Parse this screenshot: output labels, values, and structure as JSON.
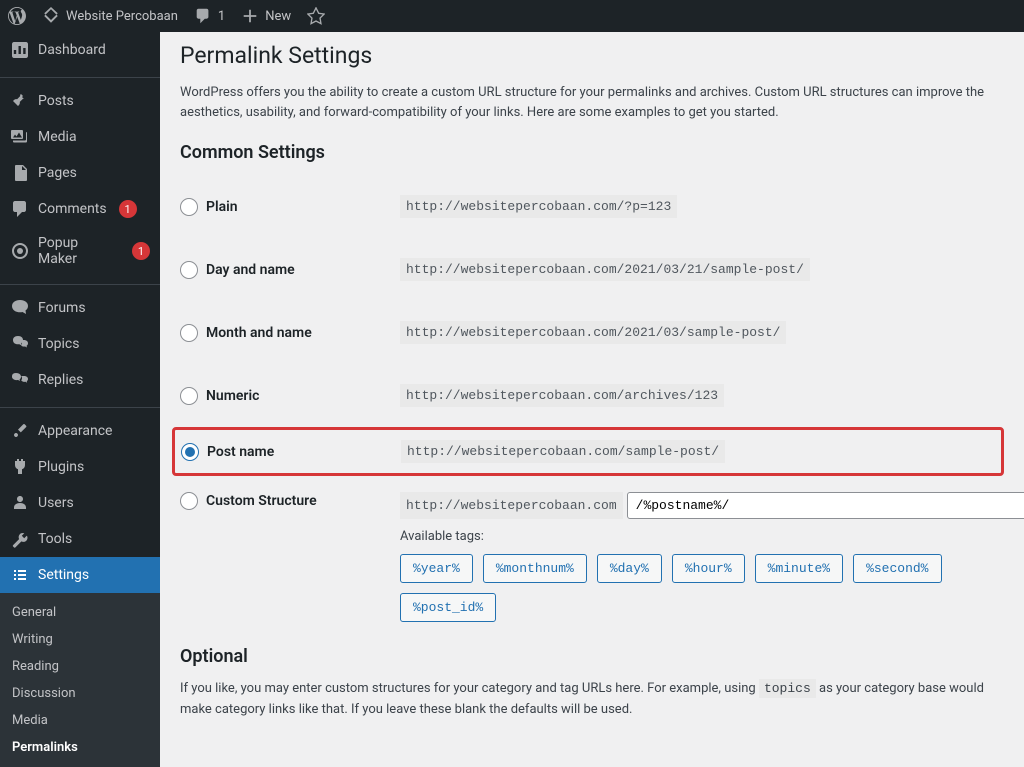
{
  "toolbar": {
    "site_name": "Website Percobaan",
    "comments_count": "1",
    "new_label": "New"
  },
  "sidebar": {
    "items": [
      {
        "label": "Dashboard"
      },
      {
        "label": "Posts"
      },
      {
        "label": "Media"
      },
      {
        "label": "Pages"
      },
      {
        "label": "Comments",
        "badge": "1"
      },
      {
        "label": "Popup Maker",
        "badge": "1"
      },
      {
        "label": "Forums"
      },
      {
        "label": "Topics"
      },
      {
        "label": "Replies"
      },
      {
        "label": "Appearance"
      },
      {
        "label": "Plugins"
      },
      {
        "label": "Users"
      },
      {
        "label": "Tools"
      },
      {
        "label": "Settings"
      }
    ],
    "submenu": [
      {
        "label": "General"
      },
      {
        "label": "Writing"
      },
      {
        "label": "Reading"
      },
      {
        "label": "Discussion"
      },
      {
        "label": "Media"
      },
      {
        "label": "Permalinks"
      }
    ]
  },
  "page": {
    "title": "Permalink Settings",
    "intro": "WordPress offers you the ability to create a custom URL structure for your permalinks and archives. Custom URL structures can improve the aesthetics, usability, and forward-compatibility of your links. Here are some examples to get you started.",
    "common_heading": "Common Settings",
    "options": [
      {
        "label": "Plain",
        "example": "http://websitepercobaan.com/?p=123",
        "checked": false
      },
      {
        "label": "Day and name",
        "example": "http://websitepercobaan.com/2021/03/21/sample-post/",
        "checked": false
      },
      {
        "label": "Month and name",
        "example": "http://websitepercobaan.com/2021/03/sample-post/",
        "checked": false
      },
      {
        "label": "Numeric",
        "example": "http://websitepercobaan.com/archives/123",
        "checked": false
      },
      {
        "label": "Post name",
        "example": "http://websitepercobaan.com/sample-post/",
        "checked": true
      },
      {
        "label": "Custom Structure"
      }
    ],
    "custom_base": "http://websitepercobaan.com",
    "custom_value": "/%postname%/",
    "available_tags_label": "Available tags:",
    "tags": [
      "%year%",
      "%monthnum%",
      "%day%",
      "%hour%",
      "%minute%",
      "%second%",
      "%post_id%"
    ],
    "optional_heading": "Optional",
    "optional_desc_1": "If you like, you may enter custom structures for your category and tag URLs here. For example, using ",
    "optional_code": "topics",
    "optional_desc_2": " as your category base would make category links like that. If you leave these blank the defaults will be used."
  }
}
